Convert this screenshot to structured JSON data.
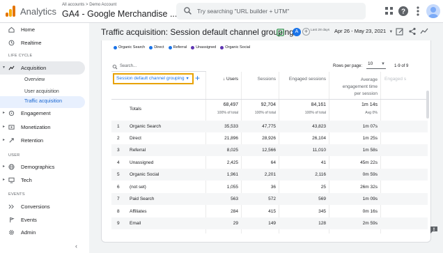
{
  "topbar": {
    "app_name": "Analytics",
    "breadcrumb": "All accounts > Demo Account",
    "property": "GA4 - Google Merchandise ...",
    "search_placeholder": "Try searching \"URL builder + UTM\""
  },
  "sidebar": {
    "items": [
      {
        "label": "Home",
        "icon": "home-icon"
      },
      {
        "label": "Realtime",
        "icon": "realtime-icon"
      }
    ],
    "section_lifecycle": "LIFE CYCLE",
    "acquisition": {
      "label": "Acquisition",
      "icon": "acquisition-icon"
    },
    "acquisition_sub": [
      "Overview",
      "User acquisition",
      "Traffic acquisition"
    ],
    "lifecycle_items": [
      {
        "label": "Engagement",
        "icon": "engagement-icon"
      },
      {
        "label": "Monetization",
        "icon": "monetization-icon"
      },
      {
        "label": "Retention",
        "icon": "retention-icon"
      }
    ],
    "section_user": "USER",
    "user_items": [
      {
        "label": "Demographics",
        "icon": "globe-icon"
      },
      {
        "label": "Tech",
        "icon": "tech-icon"
      }
    ],
    "section_events": "EVENTS",
    "event_items": [
      {
        "label": "Conversions",
        "icon": "conversions-icon"
      },
      {
        "label": "Events",
        "icon": "events-icon"
      }
    ],
    "admin": "Admin",
    "collapse_glyph": "‹"
  },
  "report": {
    "title": "Traffic acquisition: Session default channel grouping",
    "compare_badge": "A",
    "date_label": "Last 28 days",
    "date_range": "Apr 26 - May 23, 2021"
  },
  "legend": [
    {
      "label": "Organic Search",
      "color": "#1a73e8"
    },
    {
      "label": "Direct",
      "color": "#1a73e8"
    },
    {
      "label": "Referral",
      "color": "#1a73e8"
    },
    {
      "label": "Unassigned",
      "color": "#5e35b1"
    },
    {
      "label": "Organic Social",
      "color": "#5e35b1"
    }
  ],
  "table": {
    "search_placeholder": "Search...",
    "rows_per_page_label": "Rows per page:",
    "rows_per_page": "10",
    "pager": "1-9 of 9",
    "dimension": "Session default channel grouping",
    "columns": {
      "users": "↓ Users",
      "sessions": "Sessions",
      "engaged": "Engaged sessions",
      "avg_line1": "Average",
      "avg_line2": "engagement time",
      "avg_line3": "per session",
      "engaged_cut": "Engaged s"
    },
    "totals": {
      "label": "Totals",
      "users": "68,497",
      "users_sub": "100% of total",
      "sessions": "92,704",
      "sessions_sub": "100% of total",
      "engaged": "84,161",
      "engaged_sub": "100% of total",
      "avg": "1m 14s",
      "avg_sub": "Avg 0%"
    },
    "rows": [
      {
        "n": "1",
        "label": "Organic Search",
        "users": "35,533",
        "sessions": "47,775",
        "engaged": "43,823",
        "avg": "1m 07s"
      },
      {
        "n": "2",
        "label": "Direct",
        "users": "21,896",
        "sessions": "28,926",
        "engaged": "26,104",
        "avg": "1m 25s"
      },
      {
        "n": "3",
        "label": "Referral",
        "users": "8,025",
        "sessions": "12,566",
        "engaged": "11,010",
        "avg": "1m 58s"
      },
      {
        "n": "4",
        "label": "Unassigned",
        "users": "2,425",
        "sessions": "64",
        "engaged": "41",
        "avg": "45m 22s"
      },
      {
        "n": "5",
        "label": "Organic Social",
        "users": "1,961",
        "sessions": "2,201",
        "engaged": "2,116",
        "avg": "0m 59s"
      },
      {
        "n": "6",
        "label": "(not set)",
        "users": "1,055",
        "sessions": "36",
        "engaged": "25",
        "avg": "26m 32s"
      },
      {
        "n": "7",
        "label": "Paid Search",
        "users": "563",
        "sessions": "572",
        "engaged": "569",
        "avg": "1m 09s"
      },
      {
        "n": "8",
        "label": "Affiliates",
        "users": "284",
        "sessions": "415",
        "engaged": "345",
        "avg": "0m 16s"
      },
      {
        "n": "9",
        "label": "Email",
        "users": "29",
        "sessions": "149",
        "engaged": "128",
        "avg": "2m 59s"
      }
    ]
  }
}
